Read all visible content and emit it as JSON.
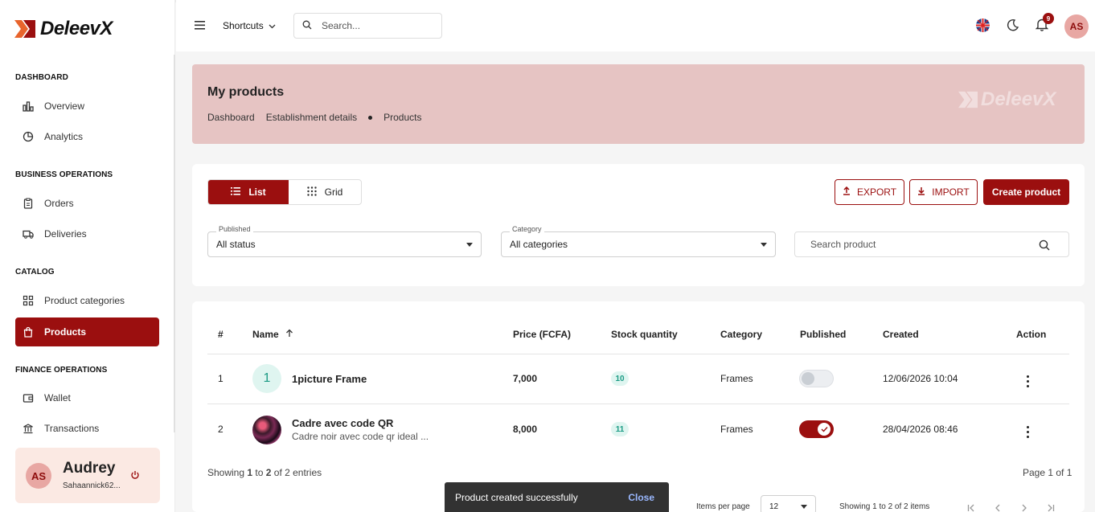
{
  "brand": {
    "name": "DeleevX",
    "accent": "#9b0f0f",
    "banner_bg": "#e6c4c3"
  },
  "sidebar": {
    "sections": [
      {
        "title": "DASHBOARD",
        "items": [
          {
            "label": "Overview",
            "icon": "bar-chart-icon"
          },
          {
            "label": "Analytics",
            "icon": "pie-chart-icon"
          }
        ]
      },
      {
        "title": "BUSINESS OPERATIONS",
        "items": [
          {
            "label": "Orders",
            "icon": "clipboard-icon"
          },
          {
            "label": "Deliveries",
            "icon": "truck-icon"
          }
        ]
      },
      {
        "title": "CATALOG",
        "items": [
          {
            "label": "Product categories",
            "icon": "grid-icon"
          },
          {
            "label": "Products",
            "icon": "bag-icon",
            "active": true
          }
        ]
      },
      {
        "title": "FINANCE OPERATIONS",
        "items": [
          {
            "label": "Wallet",
            "icon": "wallet-icon"
          },
          {
            "label": "Transactions",
            "icon": "bank-icon"
          }
        ]
      }
    ],
    "user": {
      "initials": "AS",
      "name": "Audrey",
      "email": "Sahaannick62..."
    }
  },
  "topbar": {
    "shortcuts_label": "Shortcuts",
    "search_placeholder": "Search...",
    "notification_count": "9",
    "user_initials": "AS"
  },
  "banner": {
    "title": "My products",
    "breadcrumb": [
      "Dashboard",
      "Establishment details",
      "Products"
    ],
    "watermark": "DeleevX"
  },
  "toolbar": {
    "view_list": "List",
    "view_grid": "Grid",
    "export": "EXPORT",
    "import": "IMPORT",
    "create": "Create product"
  },
  "filters": {
    "published": {
      "label": "Published",
      "value": "All status"
    },
    "category": {
      "label": "Category",
      "value": "All categories"
    },
    "search_placeholder": "Search product"
  },
  "table": {
    "headers": [
      "#",
      "Name",
      "Price (FCFA)",
      "Stock quantity",
      "Category",
      "Published",
      "Created",
      "Action"
    ],
    "rows": [
      {
        "index": "1",
        "avatar_letter": "1",
        "name": "1picture Frame",
        "subtitle": "",
        "price": "7,000",
        "stock": "10",
        "category": "Frames",
        "published": false,
        "created": "12/06/2026 10:04"
      },
      {
        "index": "2",
        "avatar_letter": "",
        "name": "Cadre avec code QR",
        "subtitle": "Cadre noir avec code qr ideal ...",
        "price": "8,000",
        "stock": "11",
        "category": "Frames",
        "published": true,
        "created": "28/04/2026 08:46"
      }
    ],
    "showing_prefix": "Showing ",
    "showing_from": "1",
    "showing_mid": " to ",
    "showing_to": "2",
    "showing_suffix": " of 2 entries",
    "page_info": "Page 1 of 1",
    "items_per_page_label": "Items per page",
    "items_per_page": "12",
    "showing_items": "Showing 1 to 2 of 2 items"
  },
  "snackbar": {
    "message": "Product created successfully",
    "action": "Close"
  }
}
